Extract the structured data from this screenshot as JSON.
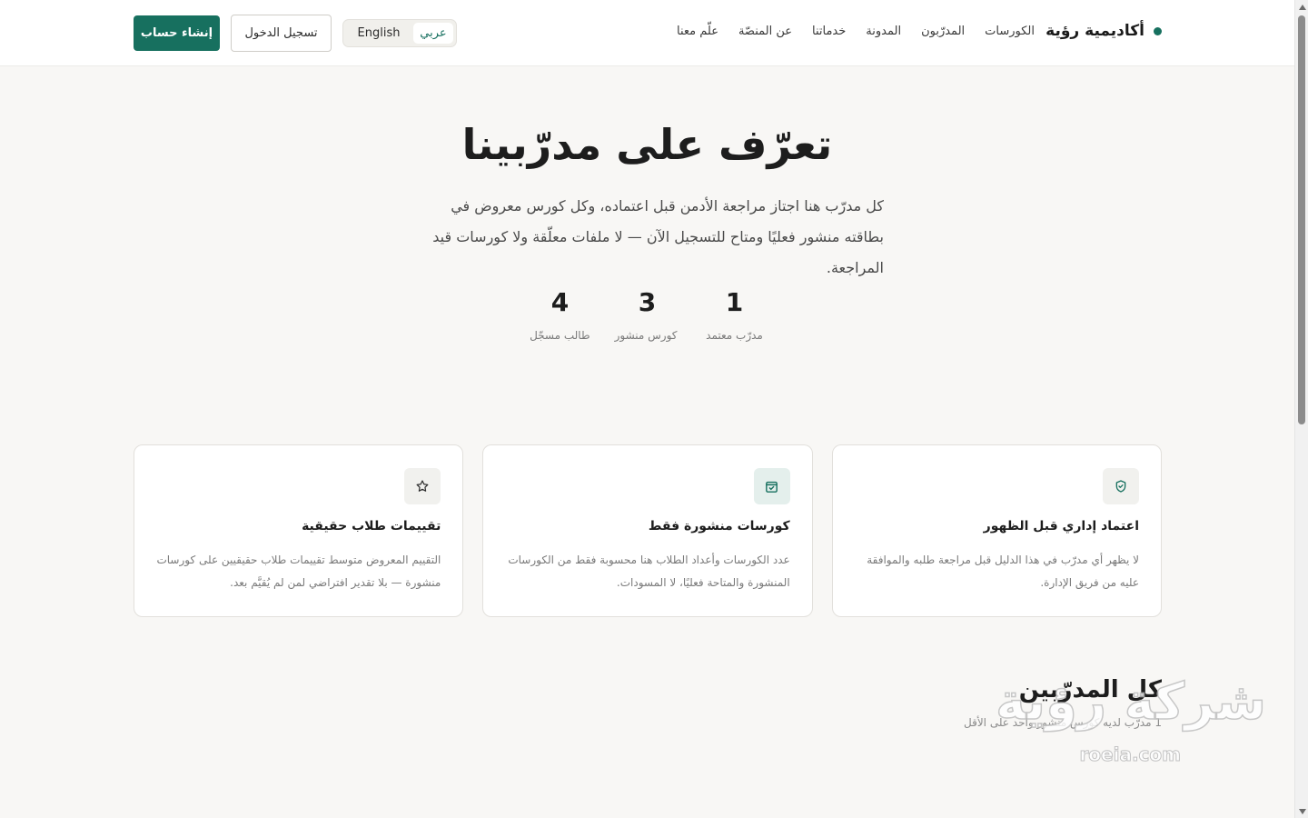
{
  "header": {
    "brand": "أكاديمية رؤية",
    "nav": [
      "الكورسات",
      "المدرّبون",
      "المدونة",
      "خدماتنا",
      "عن المنصّة",
      "علّم معنا"
    ],
    "lang": {
      "ar": "عربي",
      "en": "English"
    },
    "login_label": "تسجيل الدخول",
    "signup_label": "إنشاء حساب"
  },
  "hero": {
    "title": "تعرّف على مدرّبينا",
    "subtitle": "كل مدرّب هنا اجتاز مراجعة الأدمن قبل اعتماده، وكل كورس معروض في بطاقته منشور فعليًا ومتاح للتسجيل الآن — لا ملفات معلّقة ولا كورسات قيد المراجعة."
  },
  "stats": [
    {
      "value": "1",
      "label": "مدرّب معتمد"
    },
    {
      "value": "3",
      "label": "كورس منشور"
    },
    {
      "value": "4",
      "label": "طالب مسجّل"
    }
  ],
  "features": [
    {
      "icon": "shield-check-icon",
      "title": "اعتماد إداري قبل الظهور",
      "desc": "لا يظهر أي مدرّب في هذا الدليل قبل مراجعة طلبه والموافقة عليه من فريق الإدارة."
    },
    {
      "icon": "calendar-check-icon",
      "title": "كورسات منشورة فقط",
      "desc": "عدد الكورسات وأعداد الطلاب هنا محسوبة فقط من الكورسات المنشورة والمتاحة فعليًا، لا المسودات."
    },
    {
      "icon": "star-icon",
      "title": "تقييمات طلاب حقيقية",
      "desc": "التقييم المعروض متوسط تقييمات طلاب حقيقيين على كورسات منشورة — بلا تقدير افتراضي لمن لم يُقيَّم بعد."
    }
  ],
  "trainers_section": {
    "title": "كل المدرّبين",
    "subtitle": "1 مدرّب لديه كورس منشور واحد على الأقل"
  },
  "watermark": {
    "ar": "شركة رؤية",
    "en": "roeia.com"
  },
  "colors": {
    "accent": "#17705f",
    "background": "#f8f7f5"
  }
}
